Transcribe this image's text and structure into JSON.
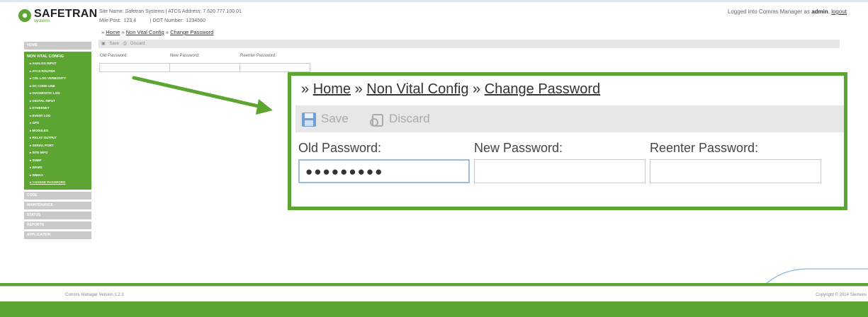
{
  "header": {
    "logo_mark": "",
    "logo_text": "SAFETRAN",
    "logo_sub": "systems",
    "site_line": "Site Name: Safetran Systems | ATCS Address: 7.620.777.100.01",
    "mile_line": "Mile Post:  123.4          | DOT Number:  1234560",
    "logged_prefix": "Logged into Comms Manager as",
    "user": "admin",
    "logout": "logout"
  },
  "breadcrumb": {
    "sep": "»",
    "home": "Home",
    "section": "Non Vital Config",
    "page": "Change Password"
  },
  "sidebar": {
    "top": "HOME",
    "active_title": "NON VITAL CONFIG",
    "items": [
      "ANALOG INPUT",
      "ATCS ROUTER",
      "CDL LOG VERBOSITY",
      "DC CODE LINE",
      "DIAGNOSTIC LOG",
      "DIGITAL INPUT",
      "ETHERNET",
      "EVENT LOG",
      "GPS",
      "MODULES",
      "RELAY OUTPUT",
      "SERIAL PORT",
      "SITE INFO",
      "SNMP",
      "WAMS",
      "WIMAX",
      "CHANGE PASSWORD"
    ],
    "bottom": [
      "CODE",
      "MAINTENANCE",
      "STATUS",
      "REPORTS",
      "APPLICATION"
    ]
  },
  "toolbar": {
    "save": "Save",
    "discard": "Discard"
  },
  "form": {
    "old_label": "Old Password:",
    "new_label": "New Password:",
    "reenter_label": "Reenter Password:",
    "old_value": "●●●●●●●●●",
    "new_value": "",
    "reenter_value": ""
  },
  "mini_form": {
    "old_label": "Old Password:",
    "new_label": "New Password:",
    "reenter_label": "Reenter Password:"
  },
  "footer": {
    "version": "Comms Manager Version 1.2.3",
    "copyright": "Copyright © 2014 Siemens"
  },
  "colors": {
    "accent": "#5da533",
    "toolbar": "#e7e7e7",
    "focus": "#9bbde0"
  }
}
